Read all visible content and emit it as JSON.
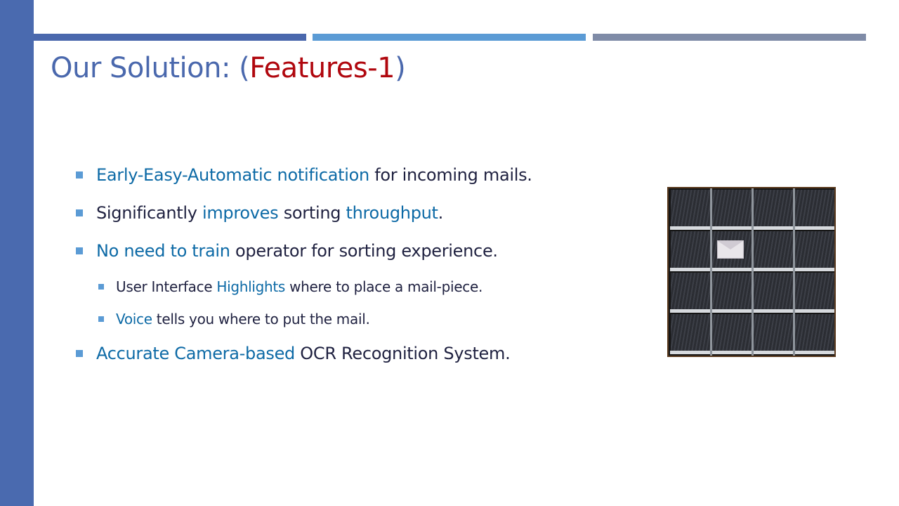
{
  "slide": {
    "title_main": "Our Solution: (",
    "title_accent": "Features-1",
    "title_close": ")"
  },
  "bullets": [
    {
      "highlight": "Early-Easy-Automatic notification",
      "text": " for incoming mails."
    },
    {
      "lead": "Significantly ",
      "highlight1": "improves",
      "mid": " sorting ",
      "highlight2": "throughput",
      "tail": "."
    },
    {
      "highlight": "No need to train",
      "text": " operator for sorting experience."
    },
    {
      "lead": "User Interface ",
      "highlight": "Highlights",
      "text": " where to place a mail-piece."
    },
    {
      "highlight": "Voice",
      "text": " tells you where to put the mail."
    },
    {
      "highlight": "Accurate Camera-based",
      "text": " OCR Recognition System."
    }
  ],
  "colors": {
    "title": "#4a68ad",
    "accent": "#b0070e",
    "highlight": "#0d6aa6",
    "body_text": "#1f2140",
    "bullet_mark": "#5b9bd5"
  }
}
